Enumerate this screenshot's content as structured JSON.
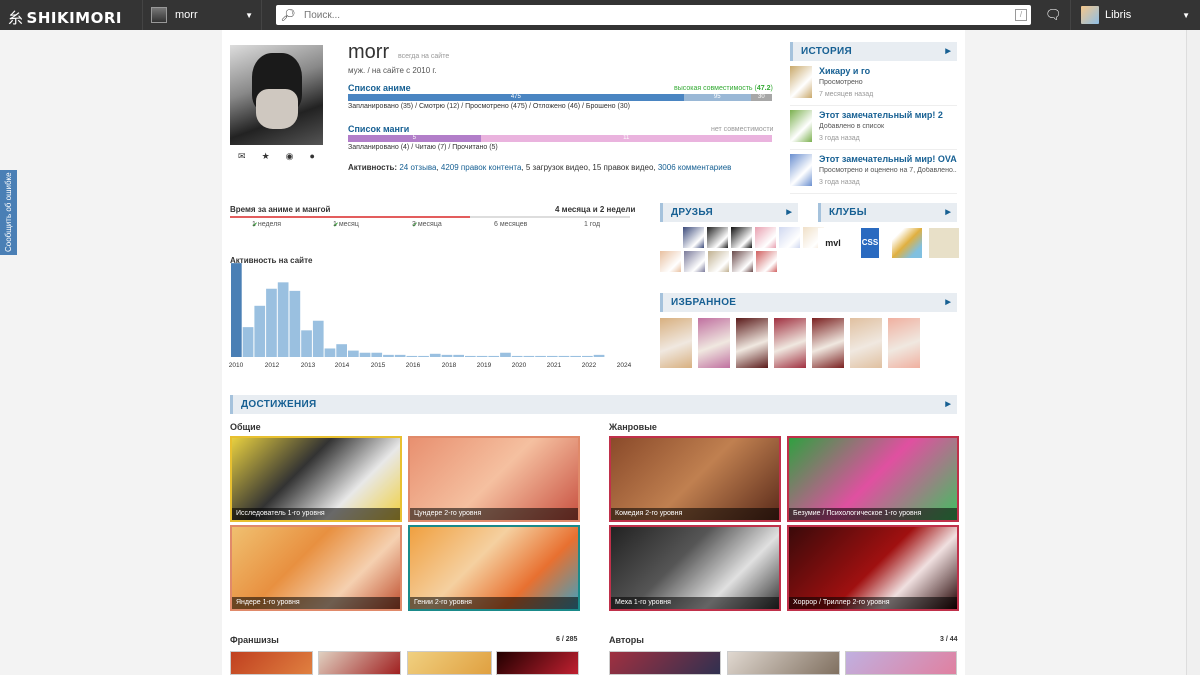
{
  "topbar": {
    "logo_glyph": "糸",
    "logo": "SHIKIMORI",
    "profile_tab": "morr",
    "search_placeholder": "Поиск...",
    "search_hotkey": "/",
    "current_user": "Libris"
  },
  "sidebar_feedback": "Сообщить об ошибке",
  "profile": {
    "name": "morr",
    "online": "всегда на сайте",
    "info": "муж.  /  на сайте с 2010 г.",
    "anime_list": {
      "label": "Список аниме",
      "compat_label": "высокая совместимость",
      "compat_value": "47.2",
      "segments": [
        {
          "label": "475",
          "value": 475,
          "color": "#4a85c2"
        },
        {
          "label": "95",
          "value": 95,
          "color": "#9ab8d6"
        },
        {
          "label": "30",
          "value": 30,
          "color": "#a7a7a7"
        }
      ],
      "legend": "Запланировано (35)  /  Смотрю (12)  /  Просмотрено (475)  /  Отложено (46)  /  Брошено (30)"
    },
    "manga_list": {
      "label": "Список манги",
      "compat_label": "нет совместимости",
      "segments": [
        {
          "label": "5",
          "value": 5,
          "color": "#b27ec9"
        },
        {
          "label": "11",
          "value": 11,
          "color": "#eab3de"
        }
      ],
      "legend": "Запланировано (4)  /  Читаю (7)  /  Прочитано (5)"
    },
    "activity": {
      "label": "Активность:",
      "items": [
        "24 отзыва",
        "4209 правок контента",
        "5 загрузок видео",
        "15 правок видео",
        "3006 комментариев"
      ]
    }
  },
  "history": {
    "title": "ИСТОРИЯ",
    "items": [
      {
        "title": "Хикару и го",
        "action": "Просмотрено",
        "date": "7 месяцев назад",
        "color": "#c9a86a"
      },
      {
        "title": "Этот замечательный мир! 2",
        "action": "Добавлено в список",
        "date": "3 года назад",
        "color": "#7bb04f"
      },
      {
        "title": "Этот замечательный мир! OVA",
        "action": "Просмотрено и оценено на 7, Добавлено...",
        "date": "3 года назад",
        "color": "#6a8fd0"
      }
    ]
  },
  "time_spent": {
    "label": "Время за аниме и мангой",
    "value": "4 месяца и 2 недели",
    "progress": 0.6,
    "ticks": [
      {
        "label": "1 неделя",
        "done": true
      },
      {
        "label": "1 месяц",
        "done": true
      },
      {
        "label": "3 месяца",
        "done": true
      },
      {
        "label": "6 месяцев",
        "done": false
      },
      {
        "label": "1 год",
        "done": false
      }
    ],
    "check_glyph": "✔"
  },
  "chart_data": {
    "type": "bar",
    "title": "Активность на сайте",
    "x_labels": [
      "2010",
      "2012",
      "2013",
      "2014",
      "2015",
      "2016",
      "2018",
      "2019",
      "2020",
      "2021",
      "2022",
      "2024"
    ],
    "values": [
      88,
      28,
      48,
      64,
      70,
      62,
      25,
      34,
      8,
      12,
      6,
      4,
      4,
      2,
      2,
      1,
      1,
      3,
      2,
      2,
      1,
      1,
      1,
      4,
      1,
      1,
      1,
      1,
      1,
      1,
      1,
      2
    ],
    "ylim": [
      0,
      90
    ],
    "color": "#5b8fc7",
    "grid": false
  },
  "friends": {
    "title": "ДРУЗЬЯ",
    "colors": [
      "#3b4a7a",
      "#222",
      "#111",
      "#e8a0b0",
      "#d0d8f0",
      "#f0e0c8",
      "#e8c0a0",
      "#7a7a9a",
      "#c0b090",
      "#6a4a4a",
      "#d06060"
    ]
  },
  "clubs": {
    "title": "КЛУБЫ",
    "items": [
      {
        "name": "mvl-club-icon",
        "label": "mvl",
        "color": "#222"
      },
      {
        "name": "css-club-icon",
        "label": "CSS",
        "color": "#2a6ac0"
      },
      {
        "name": "triangle-club-icon",
        "label": "",
        "color": "#e0b040"
      },
      {
        "name": "paper-club-icon",
        "label": "",
        "color": "#e8e0c8"
      }
    ]
  },
  "favorites": {
    "title": "ИЗБРАННОЕ",
    "colors": [
      "#d8b080",
      "#c070a0",
      "#5a1a1a",
      "#a03040",
      "#7a2020",
      "#e0c0a0",
      "#f0b0a0"
    ]
  },
  "achievements": {
    "title": "ДОСТИЖЕНИЯ",
    "general_label": "Общие",
    "genre_label": "Жанровые",
    "general": [
      {
        "label": "Исследователь 1-го уровня",
        "border": "#e8c030",
        "bg": "linear-gradient(135deg,#e8d040 0%,#333 40%,#e8e8e8 70%,#f0d040 100%)"
      },
      {
        "label": "Цундере 2-го уровня",
        "border": "#e08a6a",
        "bg": "linear-gradient(135deg,#e89070 0%,#f5c0a0 50%,#c85040 100%)"
      },
      {
        "label": "Яндере 1-го уровня",
        "border": "#e08a6a",
        "bg": "linear-gradient(135deg,#f0c070 0%,#e89040 40%,#f5d0b0 70%,#c05030 100%)"
      },
      {
        "label": "Гении 2-го уровня",
        "border": "#1a8a8a",
        "bg": "linear-gradient(135deg,#f0a040 0%,#f5d0a0 40%,#e87030 70%,#40a0c0 100%)"
      }
    ],
    "genre": [
      {
        "label": "Комедия 2-го уровня",
        "border": "#c0304a",
        "bg": "linear-gradient(135deg,#8a4a2a 0%,#c08050 50%,#5a2a1a 100%)"
      },
      {
        "label": "Безумие / Психологическое 1-го уровня",
        "border": "#c0304a",
        "bg": "linear-gradient(135deg,#30a040 0%,#e050a0 50%,#40c060 100%)"
      },
      {
        "label": "Меха 1-го уровня",
        "border": "#c0304a",
        "bg": "linear-gradient(135deg,#222 0%,#555 40%,#e0e0e0 70%,#333 100%)"
      },
      {
        "label": "Хоррор / Триллер 2-го уровня",
        "border": "#c0304a",
        "bg": "linear-gradient(135deg,#3a0a0a 0%,#a01010 50%,#f0e0e0 70%,#200 100%)"
      }
    ]
  },
  "franchises": {
    "label": "Франшизы",
    "count": "6 / 285"
  },
  "authors": {
    "label": "Авторы",
    "count": "3 / 44"
  }
}
